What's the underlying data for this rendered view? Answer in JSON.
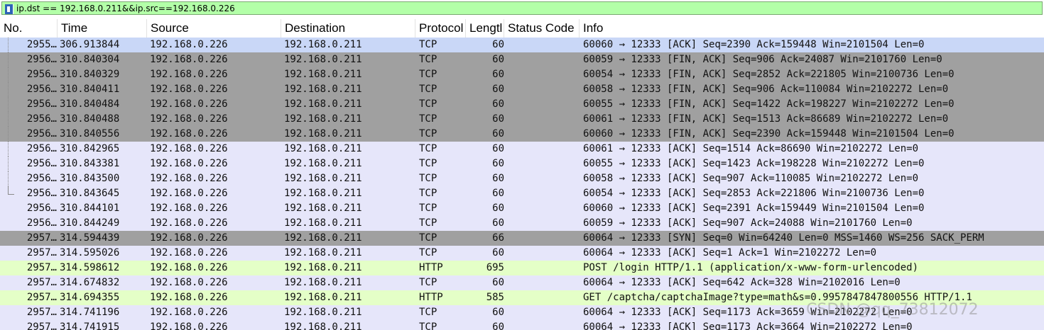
{
  "filter": {
    "value": "ip.dst == 192.168.0.211&&ip.src==192.168.0.226",
    "bg_color": "#b3ffa8"
  },
  "columns": [
    "No.",
    "Time",
    "Source",
    "Destination",
    "Protocol",
    "Lengtl",
    "Status Code",
    "Info"
  ],
  "colors": {
    "tcp": "#e6e6fa",
    "http": "#e4ffc7",
    "finsyn": "#a0a0a0",
    "selected": "#c9d7f7"
  },
  "packets": [
    {
      "no": "2955…",
      "time": "306.913844",
      "src": "192.168.0.226",
      "dst": "192.168.0.211",
      "proto": "TCP",
      "len": "60",
      "info": "60060 → 12333 [ACK] Seq=2390 Ack=159448 Win=2101504 Len=0",
      "color": "#c9d7f7",
      "tree": "line"
    },
    {
      "no": "2956…",
      "time": "310.840304",
      "src": "192.168.0.226",
      "dst": "192.168.0.211",
      "proto": "TCP",
      "len": "60",
      "info": "60059 → 12333 [FIN, ACK] Seq=906 Ack=24087 Win=2101760 Len=0",
      "color": "#a0a0a0",
      "tree": "line"
    },
    {
      "no": "2956…",
      "time": "310.840329",
      "src": "192.168.0.226",
      "dst": "192.168.0.211",
      "proto": "TCP",
      "len": "60",
      "info": "60054 → 12333 [FIN, ACK] Seq=2852 Ack=221805 Win=2100736 Len=0",
      "color": "#a0a0a0",
      "tree": "line"
    },
    {
      "no": "2956…",
      "time": "310.840411",
      "src": "192.168.0.226",
      "dst": "192.168.0.211",
      "proto": "TCP",
      "len": "60",
      "info": "60058 → 12333 [FIN, ACK] Seq=906 Ack=110084 Win=2102272 Len=0",
      "color": "#a0a0a0",
      "tree": "line"
    },
    {
      "no": "2956…",
      "time": "310.840484",
      "src": "192.168.0.226",
      "dst": "192.168.0.211",
      "proto": "TCP",
      "len": "60",
      "info": "60055 → 12333 [FIN, ACK] Seq=1422 Ack=198227 Win=2102272 Len=0",
      "color": "#a0a0a0",
      "tree": "line"
    },
    {
      "no": "2956…",
      "time": "310.840488",
      "src": "192.168.0.226",
      "dst": "192.168.0.211",
      "proto": "TCP",
      "len": "60",
      "info": "60061 → 12333 [FIN, ACK] Seq=1513 Ack=86689 Win=2102272 Len=0",
      "color": "#a0a0a0",
      "tree": "line"
    },
    {
      "no": "2956…",
      "time": "310.840556",
      "src": "192.168.0.226",
      "dst": "192.168.0.211",
      "proto": "TCP",
      "len": "60",
      "info": "60060 → 12333 [FIN, ACK] Seq=2390 Ack=159448 Win=2101504 Len=0",
      "color": "#a0a0a0",
      "tree": "line"
    },
    {
      "no": "2956…",
      "time": "310.842965",
      "src": "192.168.0.226",
      "dst": "192.168.0.211",
      "proto": "TCP",
      "len": "60",
      "info": "60061 → 12333 [ACK] Seq=1514 Ack=86690 Win=2102272 Len=0",
      "color": "#e6e6fa",
      "tree": "line"
    },
    {
      "no": "2956…",
      "time": "310.843381",
      "src": "192.168.0.226",
      "dst": "192.168.0.211",
      "proto": "TCP",
      "len": "60",
      "info": "60055 → 12333 [ACK] Seq=1423 Ack=198228 Win=2102272 Len=0",
      "color": "#e6e6fa",
      "tree": "line"
    },
    {
      "no": "2956…",
      "time": "310.843500",
      "src": "192.168.0.226",
      "dst": "192.168.0.211",
      "proto": "TCP",
      "len": "60",
      "info": "60058 → 12333 [ACK] Seq=907 Ack=110085 Win=2102272 Len=0",
      "color": "#e6e6fa",
      "tree": "line"
    },
    {
      "no": "2956…",
      "time": "310.843645",
      "src": "192.168.0.226",
      "dst": "192.168.0.211",
      "proto": "TCP",
      "len": "60",
      "info": "60054 → 12333 [ACK] Seq=2853 Ack=221806 Win=2100736 Len=0",
      "color": "#e6e6fa",
      "tree": "end"
    },
    {
      "no": "2956…",
      "time": "310.844101",
      "src": "192.168.0.226",
      "dst": "192.168.0.211",
      "proto": "TCP",
      "len": "60",
      "info": "60060 → 12333 [ACK] Seq=2391 Ack=159449 Win=2101504 Len=0",
      "color": "#e6e6fa",
      "tree": ""
    },
    {
      "no": "2956…",
      "time": "310.844249",
      "src": "192.168.0.226",
      "dst": "192.168.0.211",
      "proto": "TCP",
      "len": "60",
      "info": "60059 → 12333 [ACK] Seq=907 Ack=24088 Win=2101760 Len=0",
      "color": "#e6e6fa",
      "tree": ""
    },
    {
      "no": "2957…",
      "time": "314.594439",
      "src": "192.168.0.226",
      "dst": "192.168.0.211",
      "proto": "TCP",
      "len": "66",
      "info": "60064 → 12333 [SYN] Seq=0 Win=64240 Len=0 MSS=1460 WS=256 SACK_PERM",
      "color": "#a0a0a0",
      "tree": ""
    },
    {
      "no": "2957…",
      "time": "314.595026",
      "src": "192.168.0.226",
      "dst": "192.168.0.211",
      "proto": "TCP",
      "len": "60",
      "info": "60064 → 12333 [ACK] Seq=1 Ack=1 Win=2102272 Len=0",
      "color": "#e6e6fa",
      "tree": ""
    },
    {
      "no": "2957…",
      "time": "314.598612",
      "src": "192.168.0.226",
      "dst": "192.168.0.211",
      "proto": "HTTP",
      "len": "695",
      "info": "POST /login HTTP/1.1  (application/x-www-form-urlencoded)",
      "color": "#e4ffc7",
      "tree": ""
    },
    {
      "no": "2957…",
      "time": "314.674832",
      "src": "192.168.0.226",
      "dst": "192.168.0.211",
      "proto": "TCP",
      "len": "60",
      "info": "60064 → 12333 [ACK] Seq=642 Ack=328 Win=2102016 Len=0",
      "color": "#e6e6fa",
      "tree": ""
    },
    {
      "no": "2957…",
      "time": "314.694355",
      "src": "192.168.0.226",
      "dst": "192.168.0.211",
      "proto": "HTTP",
      "len": "585",
      "info": "GET /captcha/captchaImage?type=math&s=0.9957847847800556 HTTP/1.1",
      "color": "#e4ffc7",
      "tree": ""
    },
    {
      "no": "2957…",
      "time": "314.741196",
      "src": "192.168.0.226",
      "dst": "192.168.0.211",
      "proto": "TCP",
      "len": "60",
      "info": "60064 → 12333 [ACK] Seq=1173 Ack=3659 Win=2102272 Len=0",
      "color": "#e6e6fa",
      "tree": ""
    },
    {
      "no": "2957…",
      "time": "314.741915",
      "src": "192.168.0.226",
      "dst": "192.168.0.211",
      "proto": "TCP",
      "len": "60",
      "info": "60064 → 12333 [ACK] Seq=1173 Ack=3664 Win=2102272 Len=0",
      "color": "#e6e6fa",
      "tree": ""
    }
  ],
  "watermark": "CSDN @qq_73812072"
}
